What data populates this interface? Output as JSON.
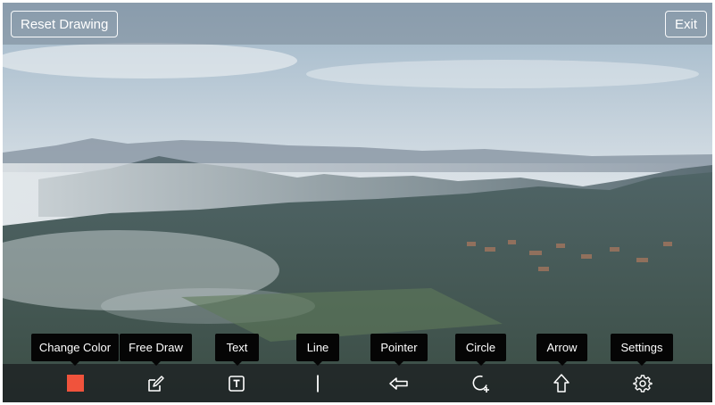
{
  "header": {
    "reset_label": "Reset Drawing",
    "exit_label": "Exit"
  },
  "toolbar": {
    "tools": [
      {
        "name": "change-color",
        "tooltip": "Change Color",
        "icon": "color-swatch-icon"
      },
      {
        "name": "free-draw",
        "tooltip": "Free Draw",
        "icon": "pencil-edit-icon"
      },
      {
        "name": "text",
        "tooltip": "Text",
        "icon": "text-box-icon"
      },
      {
        "name": "line",
        "tooltip": "Line",
        "icon": "line-icon"
      },
      {
        "name": "pointer",
        "tooltip": "Pointer",
        "icon": "left-arrow-icon"
      },
      {
        "name": "circle",
        "tooltip": "Circle",
        "icon": "circle-plus-icon"
      },
      {
        "name": "arrow",
        "tooltip": "Arrow",
        "icon": "up-arrow-icon"
      },
      {
        "name": "settings",
        "tooltip": "Settings",
        "icon": "gear-icon"
      }
    ],
    "selected_color": "#f0533c"
  },
  "colors": {
    "icon": "#ffffff",
    "tooltip_bg": "#050505",
    "toolbar_bg": "#1c1f21"
  }
}
